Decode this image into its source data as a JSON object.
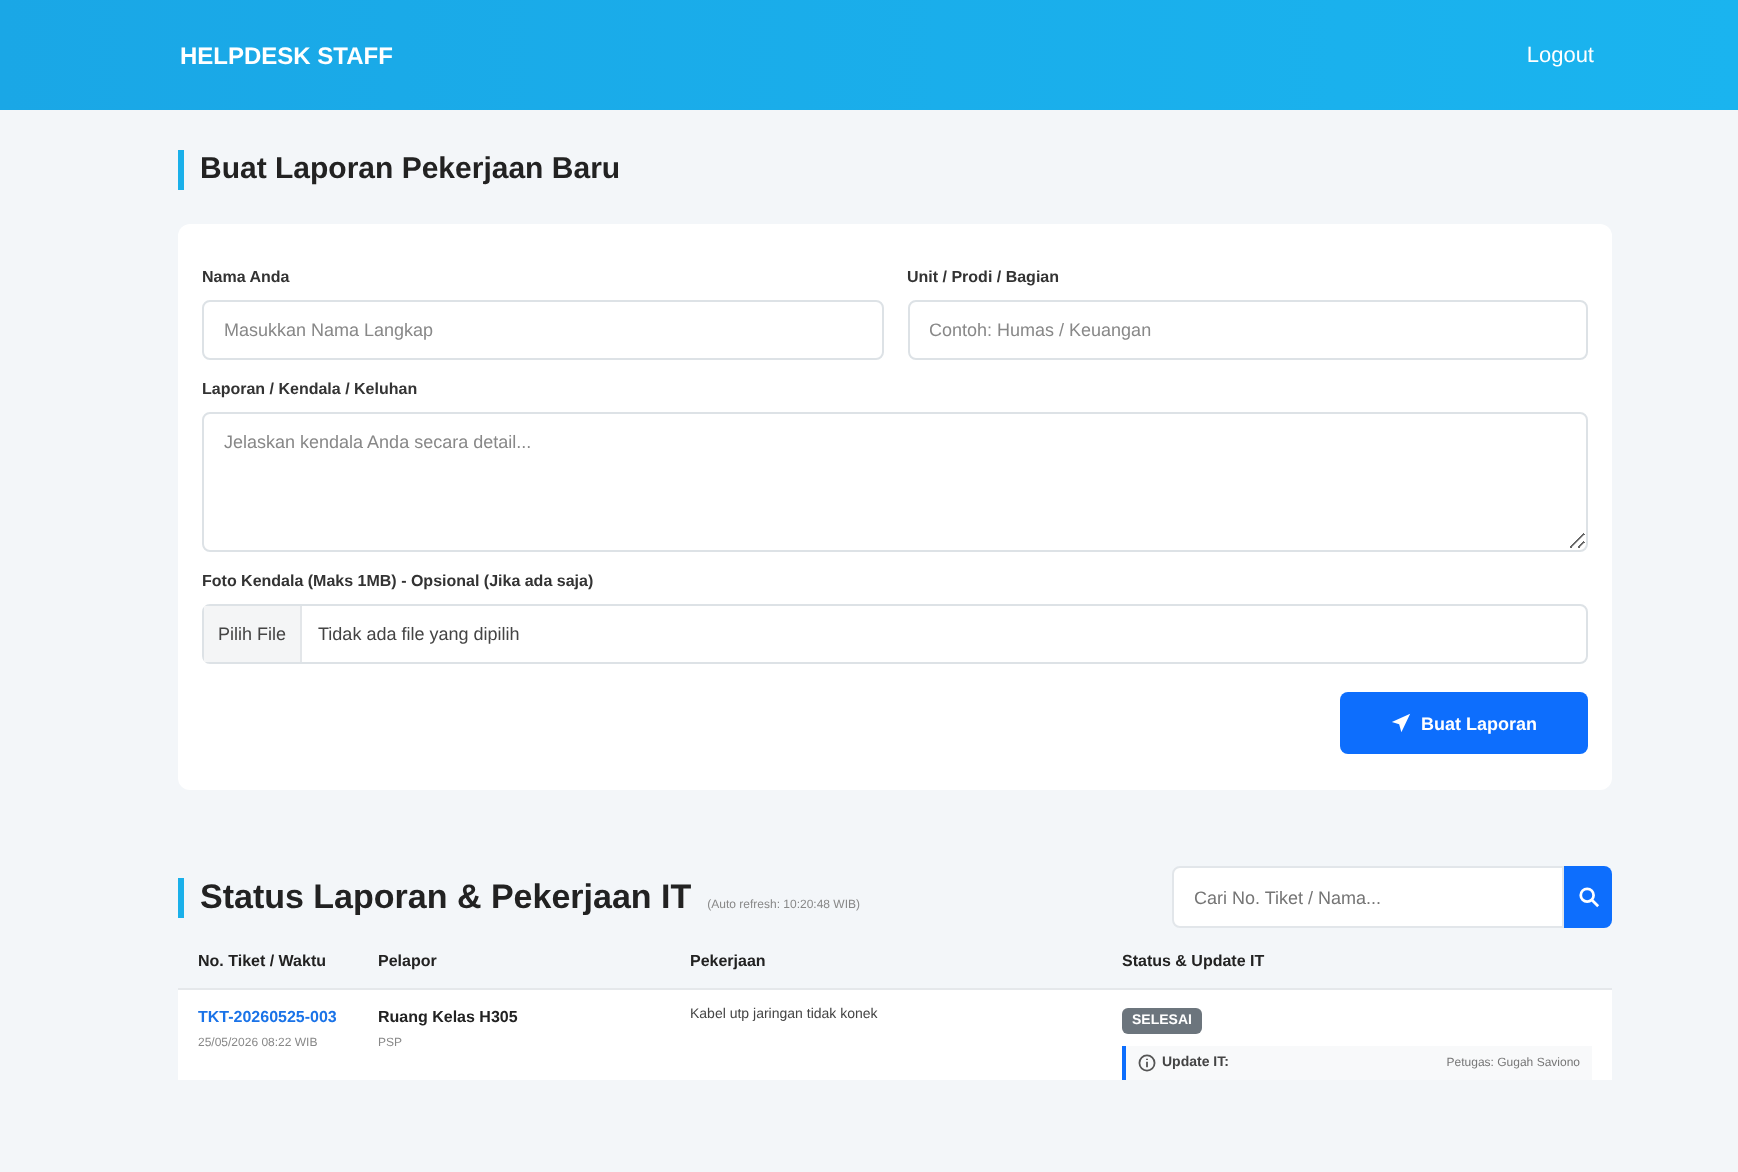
{
  "navbar": {
    "brand": "HELPDESK STAFF",
    "logout": "Logout"
  },
  "form": {
    "title": "Buat Laporan Pekerjaan Baru",
    "fields": [
      {
        "kind": "text",
        "label": "Nama Anda",
        "placeholder": "Masukkan Nama Langkap"
      },
      {
        "kind": "text",
        "label": "Unit / Prodi / Bagian",
        "placeholder": "Contoh: Humas / Keuangan"
      },
      {
        "kind": "textarea",
        "label": "Laporan / Kendala / Keluhan",
        "placeholder": "Jelaskan kendala Anda secara detail..."
      },
      {
        "kind": "file",
        "label": "Foto Kendala (Maks 1MB) - Opsional (Jika ada saja)",
        "button": "Pilih File",
        "value": "Tidak ada file yang dipilih"
      }
    ],
    "submit": "Buat Laporan"
  },
  "status": {
    "title": "Status Laporan & Pekerjaan IT",
    "refresh_note": "(Auto refresh: 10:20:48 WIB)",
    "search": {
      "placeholder": "Cari No. Tiket / Nama..."
    },
    "table": {
      "columns": [
        "No. Tiket / Waktu",
        "Pelapor",
        "Pekerjaan",
        "Status & Update IT"
      ],
      "rows": [
        {
          "ticket": "TKT-20260525-003",
          "time": "25/05/2026 08:22 WIB",
          "reporter": "Ruang Kelas H305",
          "reporter_unit": "PSP",
          "job": "Kabel utp jaringan tidak konek",
          "status": {
            "kind": "done",
            "label": "SELESAI"
          },
          "update_label": "Update IT:",
          "officer": "Petugas: Gugah Saviono"
        }
      ]
    }
  }
}
